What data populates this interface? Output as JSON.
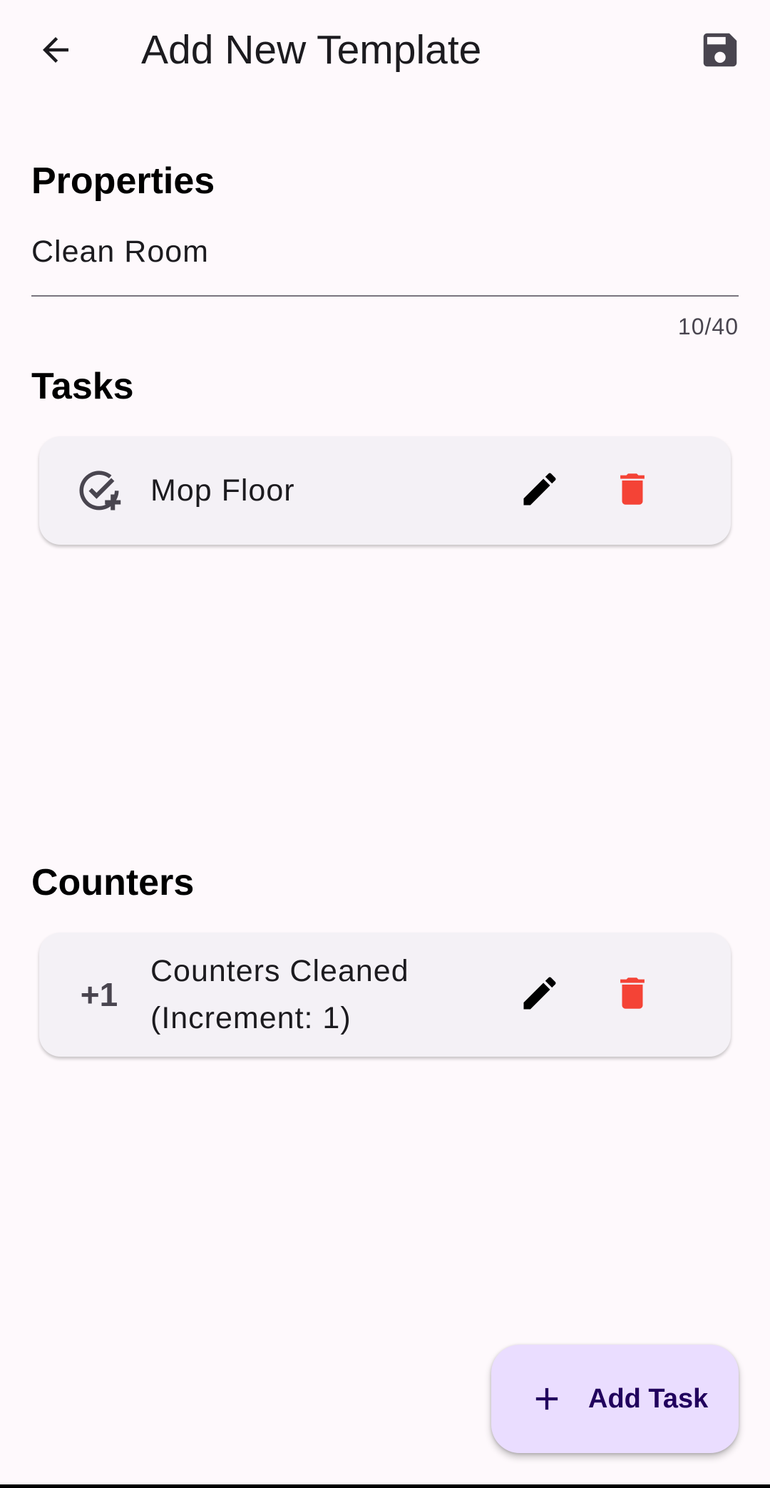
{
  "appbar": {
    "title": "Add New Template",
    "back_icon": "arrow-back-icon",
    "save_icon": "save-icon"
  },
  "properties": {
    "heading": "Properties",
    "name_value": "Clean Room",
    "char_counter": "10/40"
  },
  "tasks": {
    "heading": "Tasks",
    "items": [
      {
        "label": "Mop Floor",
        "icon": "task-add-icon"
      }
    ]
  },
  "counters": {
    "heading": "Counters",
    "items": [
      {
        "badge": "+1",
        "line1": "Counters Cleaned",
        "line2": "(Increment: 1)"
      }
    ]
  },
  "fab": {
    "label": "Add Task",
    "icon": "plus-icon"
  },
  "colors": {
    "background": "#FEF9FC",
    "card": "#F4F1F6",
    "delete": "#F44336",
    "fab": "#EADDFF",
    "fab_text": "#21005D"
  }
}
